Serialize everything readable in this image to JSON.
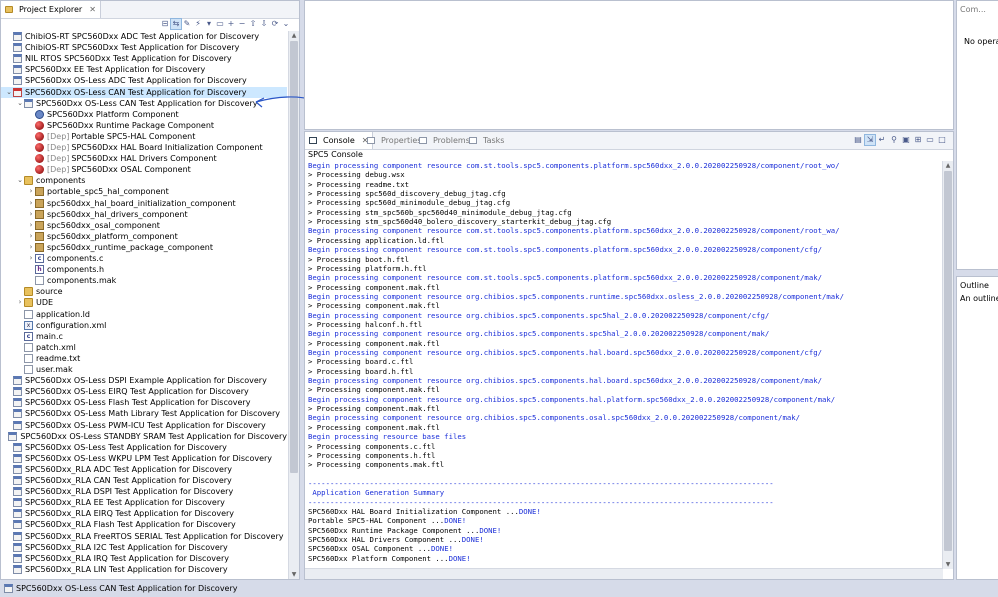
{
  "explorer": {
    "tab_label": "Project Explorer",
    "tree": [
      {
        "text": "ChibiOS-RT SPC560Dxx ADC Test Application for Discovery",
        "icon": "project-icon",
        "level": 0,
        "tw": ""
      },
      {
        "text": "ChibiOS-RT SPC560Dxx Test Application for Discovery",
        "icon": "project-icon",
        "level": 0,
        "tw": ""
      },
      {
        "text": "NIL RTOS SPC560Dxx Test Application for Discovery",
        "icon": "project-icon",
        "level": 0,
        "tw": ""
      },
      {
        "text": "SPC560Dxx EE Test Application for Discovery",
        "icon": "project-icon",
        "level": 0,
        "tw": ""
      },
      {
        "text": "SPC560Dxx OS-Less ADC Test Application for Discovery",
        "icon": "project-icon",
        "level": 0,
        "tw": ""
      },
      {
        "text": "SPC560Dxx OS-Less CAN Test Application for Discovery",
        "icon": "project-error-icon",
        "level": 0,
        "tw": "v",
        "selected": true
      },
      {
        "text": "SPC560Dxx OS-Less CAN Test Application for Discovery",
        "icon": "configuration-icon",
        "level": 1,
        "tw": "v"
      },
      {
        "text": "SPC560Dxx Platform Component",
        "icon": "component-icon",
        "level": 2,
        "tw": ""
      },
      {
        "text": "SPC560Dxx Runtime Package Component",
        "icon": "component-ball-icon",
        "level": 2,
        "tw": ""
      },
      {
        "text": "Portable SPC5-HAL Component",
        "dep": "[Dep]",
        "icon": "component-ball-icon",
        "level": 2,
        "tw": ""
      },
      {
        "text": "SPC560Dxx HAL Board Initialization Component",
        "dep": "[Dep]",
        "icon": "component-ball-icon",
        "level": 2,
        "tw": ""
      },
      {
        "text": "SPC560Dxx HAL Drivers Component",
        "dep": "[Dep]",
        "icon": "component-ball-icon",
        "level": 2,
        "tw": ""
      },
      {
        "text": "SPC560Dxx OSAL Component",
        "dep": "[Dep]",
        "icon": "component-ball-icon",
        "level": 2,
        "tw": ""
      },
      {
        "text": "components",
        "icon": "folder-icon",
        "level": 1,
        "tw": "v"
      },
      {
        "text": "portable_spc5_hal_component",
        "icon": "package-icon",
        "level": 2,
        "tw": ">"
      },
      {
        "text": "spc560dxx_hal_board_initialization_component",
        "icon": "package-icon",
        "level": 2,
        "tw": ">"
      },
      {
        "text": "spc560dxx_hal_drivers_component",
        "icon": "package-icon",
        "level": 2,
        "tw": ">"
      },
      {
        "text": "spc560dxx_osal_component",
        "icon": "package-icon",
        "level": 2,
        "tw": ">"
      },
      {
        "text": "spc560dxx_platform_component",
        "icon": "package-icon",
        "level": 2,
        "tw": ">"
      },
      {
        "text": "spc560dxx_runtime_package_component",
        "icon": "package-icon",
        "level": 2,
        "tw": ">"
      },
      {
        "text": "components.c",
        "icon": "c-file-icon",
        "level": 2,
        "tw": ">"
      },
      {
        "text": "components.h",
        "icon": "h-file-icon",
        "level": 2,
        "tw": ""
      },
      {
        "text": "components.mak",
        "icon": "file-icon",
        "level": 2,
        "tw": ""
      },
      {
        "text": "source",
        "icon": "folder-icon",
        "level": 1,
        "tw": ""
      },
      {
        "text": "UDE",
        "icon": "folder-icon",
        "level": 1,
        "tw": ">"
      },
      {
        "text": "application.ld",
        "icon": "file-icon",
        "level": 1,
        "tw": ""
      },
      {
        "text": "configuration.xml",
        "icon": "xml-file-icon",
        "level": 1,
        "tw": ""
      },
      {
        "text": "main.c",
        "icon": "c-file-icon",
        "level": 1,
        "tw": ""
      },
      {
        "text": "patch.xml",
        "icon": "file-icon",
        "level": 1,
        "tw": ""
      },
      {
        "text": "readme.txt",
        "icon": "file-icon",
        "level": 1,
        "tw": ""
      },
      {
        "text": "user.mak",
        "icon": "file-icon",
        "level": 1,
        "tw": ""
      },
      {
        "text": "SPC560Dxx OS-Less DSPI Example Application for Discovery",
        "icon": "project-icon",
        "level": 0,
        "tw": ""
      },
      {
        "text": "SPC560Dxx OS-Less EIRQ Test Application for Discovery",
        "icon": "project-icon",
        "level": 0,
        "tw": ""
      },
      {
        "text": "SPC560Dxx OS-Less Flash Test Application for Discovery",
        "icon": "project-icon",
        "level": 0,
        "tw": ""
      },
      {
        "text": "SPC560Dxx OS-Less Math Library Test Application for Discovery",
        "icon": "project-icon",
        "level": 0,
        "tw": ""
      },
      {
        "text": "SPC560Dxx OS-Less PWM-ICU Test Application for Discovery",
        "icon": "project-icon",
        "level": 0,
        "tw": ""
      },
      {
        "text": "SPC560Dxx OS-Less STANDBY SRAM Test Application for Discovery",
        "icon": "project-icon",
        "level": 0,
        "tw": ""
      },
      {
        "text": "SPC560Dxx OS-Less Test Application for Discovery",
        "icon": "project-icon",
        "level": 0,
        "tw": ""
      },
      {
        "text": "SPC560Dxx OS-Less WKPU LPM Test Application for Discovery",
        "icon": "project-icon",
        "level": 0,
        "tw": ""
      },
      {
        "text": "SPC560Dxx_RLA ADC Test Application for Discovery",
        "icon": "project-icon",
        "level": 0,
        "tw": ""
      },
      {
        "text": "SPC560Dxx_RLA CAN Test Application for Discovery",
        "icon": "project-icon",
        "level": 0,
        "tw": ""
      },
      {
        "text": "SPC560Dxx_RLA DSPI Test Application for Discovery",
        "icon": "project-icon",
        "level": 0,
        "tw": ""
      },
      {
        "text": "SPC560Dxx_RLA EE Test Application for Discovery",
        "icon": "project-icon",
        "level": 0,
        "tw": ""
      },
      {
        "text": "SPC560Dxx_RLA EIRQ Test Application for Discovery",
        "icon": "project-icon",
        "level": 0,
        "tw": ""
      },
      {
        "text": "SPC560Dxx_RLA Flash Test Application for Discovery",
        "icon": "project-icon",
        "level": 0,
        "tw": ""
      },
      {
        "text": "SPC560Dxx_RLA FreeRTOS SERIAL Test Application for Discovery",
        "icon": "project-icon",
        "level": 0,
        "tw": ""
      },
      {
        "text": "SPC560Dxx_RLA I2C Test Application for Discovery",
        "icon": "project-icon",
        "level": 0,
        "tw": ""
      },
      {
        "text": "SPC560Dxx_RLA IRQ Test Application for Discovery",
        "icon": "project-icon",
        "level": 0,
        "tw": ""
      },
      {
        "text": "SPC560Dxx_RLA LIN Test Application for Discovery",
        "icon": "project-icon",
        "level": 0,
        "tw": ""
      }
    ]
  },
  "console": {
    "tabs": [
      {
        "label": "Console",
        "active": true
      },
      {
        "label": "Properties",
        "active": false
      },
      {
        "label": "Problems",
        "active": false
      },
      {
        "label": "Tasks",
        "active": false
      }
    ],
    "title": "SPC5 Console",
    "lines": [
      {
        "text": "Begin processing component resource com.st.tools.spc5.components.platform.spc560dxx_2.0.0.202002250928/component/root_wo/",
        "style": "blue"
      },
      {
        "text": "> Processing debug.wsx",
        "style": "normal"
      },
      {
        "text": "> Processing readme.txt",
        "style": "normal"
      },
      {
        "text": "> Processing spc560d_discovery_debug_jtag.cfg",
        "style": "normal"
      },
      {
        "text": "> Processing spc560d_minimodule_debug_jtag.cfg",
        "style": "normal"
      },
      {
        "text": "> Processing stm_spc560b_spc560d40_minimodule_debug_jtag.cfg",
        "style": "normal"
      },
      {
        "text": "> Processing stm_spc560d40_bolero_discovery_starterkit_debug_jtag.cfg",
        "style": "normal"
      },
      {
        "text": "Begin processing component resource com.st.tools.spc5.components.platform.spc560dxx_2.0.0.202002250928/component/root_wa/",
        "style": "blue"
      },
      {
        "text": "> Processing application.ld.ftl",
        "style": "normal"
      },
      {
        "text": "Begin processing component resource com.st.tools.spc5.components.platform.spc560dxx_2.0.0.202002250928/component/cfg/",
        "style": "blue"
      },
      {
        "text": "> Processing boot.h.ftl",
        "style": "normal"
      },
      {
        "text": "> Processing platform.h.ftl",
        "style": "normal"
      },
      {
        "text": "Begin processing component resource com.st.tools.spc5.components.platform.spc560dxx_2.0.0.202002250928/component/mak/",
        "style": "blue"
      },
      {
        "text": "> Processing component.mak.ftl",
        "style": "normal"
      },
      {
        "text": "Begin processing component resource org.chibios.spc5.components.runtime.spc560dxx.osless_2.0.0.202002250928/component/mak/",
        "style": "blue"
      },
      {
        "text": "> Processing component.mak.ftl",
        "style": "normal"
      },
      {
        "text": "Begin processing component resource org.chibios.spc5.components.spc5hal_2.0.0.202002250928/component/cfg/",
        "style": "blue"
      },
      {
        "text": "> Processing halconf.h.ftl",
        "style": "normal"
      },
      {
        "text": "Begin processing component resource org.chibios.spc5.components.spc5hal_2.0.0.202002250928/component/mak/",
        "style": "blue"
      },
      {
        "text": "> Processing component.mak.ftl",
        "style": "normal"
      },
      {
        "text": "Begin processing component resource org.chibios.spc5.components.hal.board.spc560dxx_2.0.0.202002250928/component/cfg/",
        "style": "blue"
      },
      {
        "text": "> Processing board.c.ftl",
        "style": "normal"
      },
      {
        "text": "> Processing board.h.ftl",
        "style": "normal"
      },
      {
        "text": "Begin processing component resource org.chibios.spc5.components.hal.board.spc560dxx_2.0.0.202002250928/component/mak/",
        "style": "blue"
      },
      {
        "text": "> Processing component.mak.ftl",
        "style": "normal"
      },
      {
        "text": "Begin processing component resource org.chibios.spc5.components.hal.platform.spc560dxx_2.0.0.202002250928/component/mak/",
        "style": "blue"
      },
      {
        "text": "> Processing component.mak.ftl",
        "style": "normal"
      },
      {
        "text": "Begin processing component resource org.chibios.spc5.components.osal.spc560dxx_2.0.0.202002250928/component/mak/",
        "style": "blue"
      },
      {
        "text": "> Processing component.mak.ftl",
        "style": "normal"
      },
      {
        "text": "Begin processing resource base files",
        "style": "blue"
      },
      {
        "text": "> Processing components.c.ftl",
        "style": "normal"
      },
      {
        "text": "> Processing components.h.ftl",
        "style": "normal"
      },
      {
        "text": "> Processing components.mak.ftl",
        "style": "normal"
      },
      {
        "text": "",
        "style": "normal"
      },
      {
        "text": "----------------------------------------------------------------------------------------------------------",
        "style": "blue"
      },
      {
        "text": " Application Generation Summary",
        "style": "blue"
      },
      {
        "text": "----------------------------------------------------------------------------------------------------------",
        "style": "blue"
      },
      {
        "text": "SPC560Dxx HAL Board Initialization Component ...",
        "done": "DONE!",
        "style": "done"
      },
      {
        "text": "Portable SPC5-HAL Component ...",
        "done": "DONE!",
        "style": "done"
      },
      {
        "text": "SPC560Dxx Runtime Package Component ...",
        "done": "DONE!",
        "style": "done"
      },
      {
        "text": "SPC560Dxx HAL Drivers Component ...",
        "done": "DONE!",
        "style": "done"
      },
      {
        "text": "SPC560Dxx OSAL Component ...",
        "done": "DONE!",
        "style": "done"
      },
      {
        "text": "SPC560Dxx Platform Component ...",
        "done": "DONE!",
        "style": "done"
      }
    ]
  },
  "right_top": {
    "tab_label": "Com...",
    "text": "No operati"
  },
  "right_bottom": {
    "tab_label": "Outline",
    "text": "An outline is"
  },
  "statusbar": {
    "text": "SPC560Dxx OS-Less CAN Test Application for Discovery"
  },
  "colors": {
    "console_blue": "#1a2ed8",
    "selection": "#cde8ff",
    "chrome": "#d6dbe9"
  }
}
